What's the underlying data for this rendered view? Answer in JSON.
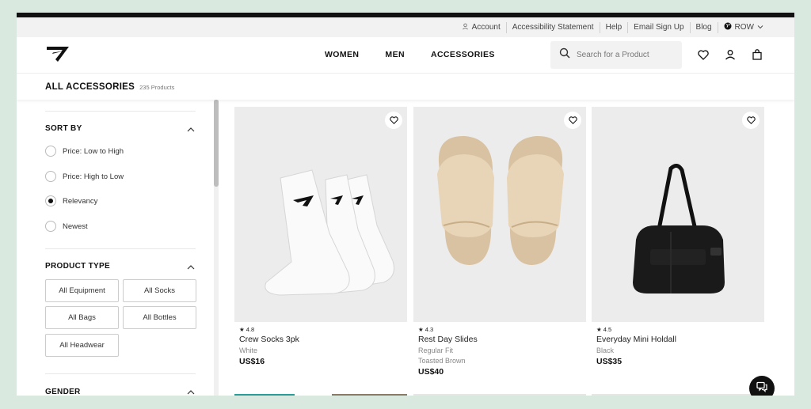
{
  "utility_bar": {
    "account": "Account",
    "accessibility": "Accessibility Statement",
    "help": "Help",
    "email_signup": "Email Sign Up",
    "blog": "Blog",
    "region": "ROW"
  },
  "header": {
    "nav": [
      "WOMEN",
      "MEN",
      "ACCESSORIES"
    ],
    "search_placeholder": "Search for a Product"
  },
  "page": {
    "title": "ALL ACCESSORIES",
    "product_count": "235 Products"
  },
  "sidebar": {
    "sort_by": {
      "title": "SORT BY",
      "options": [
        "Price: Low to High",
        "Price: High to Low",
        "Relevancy",
        "Newest"
      ],
      "selected": "Relevancy"
    },
    "product_type": {
      "title": "PRODUCT TYPE",
      "chips": [
        "All Equipment",
        "All Socks",
        "All Bags",
        "All Bottles",
        "All Headwear"
      ]
    },
    "gender": {
      "title": "GENDER"
    }
  },
  "products": [
    {
      "rating": "★ 4.8",
      "name": "Crew Socks 3pk",
      "color": "White",
      "color2": "",
      "price": "US$16"
    },
    {
      "rating": "★ 4.3",
      "name": "Rest Day Slides",
      "color": "Regular Fit",
      "color2": "Toasted Brown",
      "price": "US$40"
    },
    {
      "rating": "★ 4.5",
      "name": "Everyday Mini Holdall",
      "color": "Black",
      "color2": "",
      "price": "US$35"
    }
  ],
  "colors": {
    "background": "#d9e9df",
    "text": "#222222",
    "card_bg": "#ececec",
    "accent": "#111111"
  },
  "icons": [
    "user-icon",
    "globe-icon",
    "chevron-down-icon",
    "search-icon",
    "heart-icon",
    "account-icon",
    "bag-icon",
    "chevron-up-icon",
    "chat-icon"
  ]
}
